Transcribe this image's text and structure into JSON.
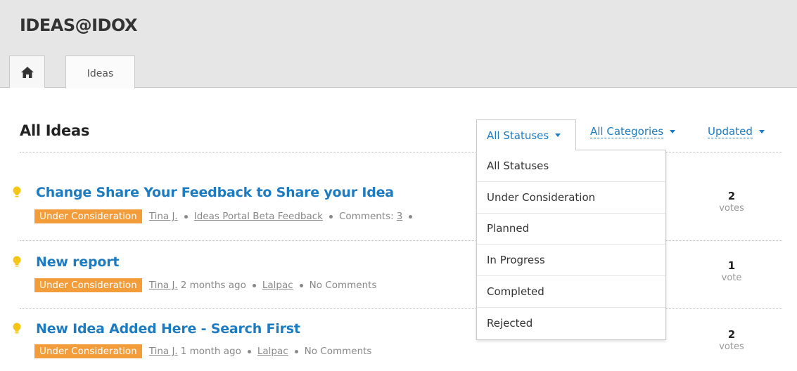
{
  "header": {
    "brand": "IDEAS@IDOX",
    "home_icon": "home-icon",
    "tabs": [
      {
        "label": "Ideas"
      }
    ]
  },
  "main": {
    "title": "All Ideas",
    "filters": {
      "status": "All Statuses",
      "category": "All Categories",
      "sort": "Updated"
    },
    "status_options": [
      "All Statuses",
      "Under Consideration",
      "Planned",
      "In Progress",
      "Completed",
      "Rejected"
    ],
    "ideas": [
      {
        "title": "Change Share Your Feedback to Share your Idea",
        "status": "Under Consideration",
        "author": "Tina J.",
        "time": "",
        "category": "Ideas Portal Beta Feedback",
        "comments_label": "Comments:",
        "comments_count": "3",
        "votes": "2",
        "votes_label": "votes"
      },
      {
        "title": "New report",
        "status": "Under Consideration",
        "author": "Tina J.",
        "time": "2 months ago",
        "category": "Lalpac",
        "comments_label": "No Comments",
        "votes": "1",
        "votes_label": "vote"
      },
      {
        "title": "New Idea Added Here - Search First",
        "status": "Under Consideration",
        "author": "Tina J.",
        "time": "1 month ago",
        "category": "Lalpac",
        "comments_label": "No Comments",
        "votes": "2",
        "votes_label": "votes"
      }
    ]
  },
  "colors": {
    "accent": "#1c7bc1",
    "badge": "#f39c3a",
    "bulb": "#f5c518",
    "header_bg": "#e6e6e6"
  }
}
